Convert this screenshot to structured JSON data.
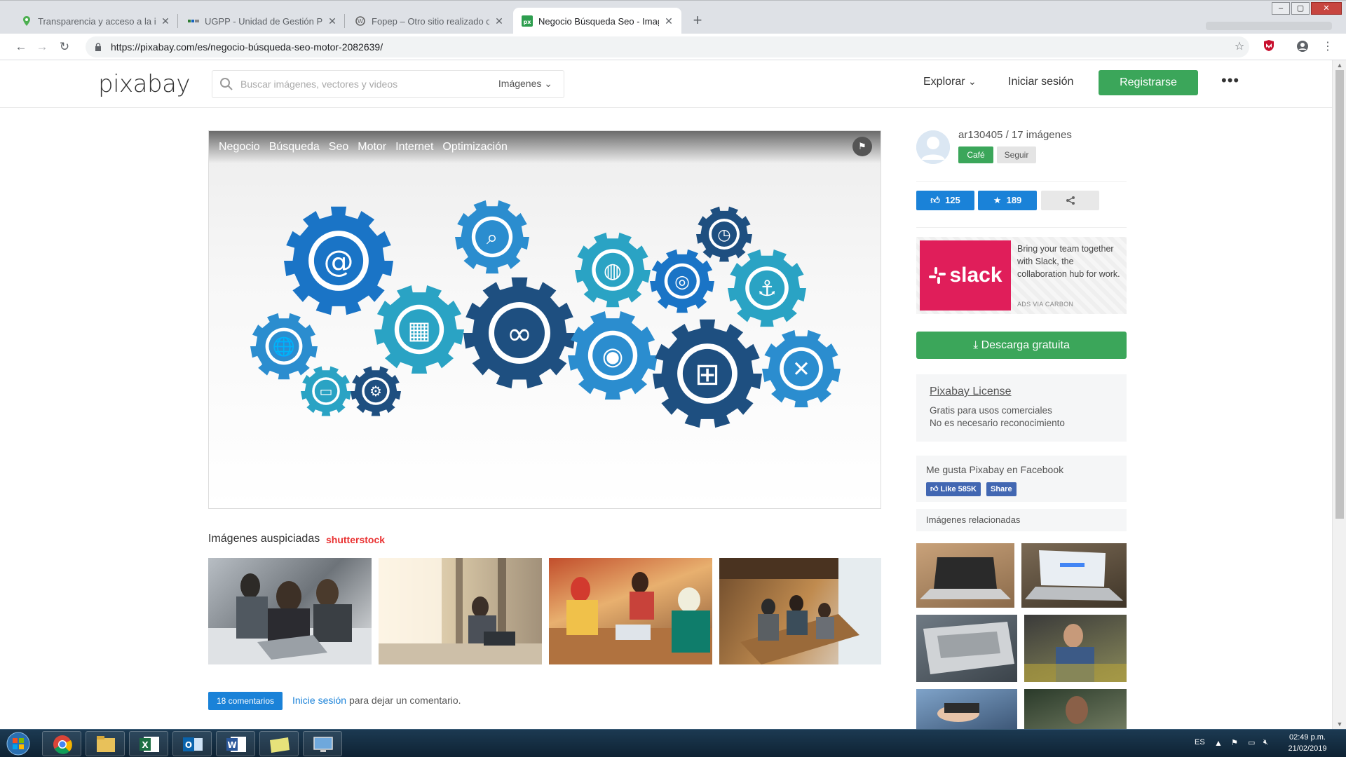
{
  "browser": {
    "tabs": [
      {
        "title": "Transparencia y acceso a la inform",
        "favicon": "location-pin-icon",
        "active": false
      },
      {
        "title": "UGPP - Unidad de Gestión Pensio",
        "favicon": "ugpp-icon",
        "active": false
      },
      {
        "title": "Fopep – Otro sitio realizado con",
        "favicon": "wordpress-icon",
        "active": false
      },
      {
        "title": "Negocio Búsqueda Seo - Imagen",
        "favicon": "pixabay-icon",
        "active": true
      }
    ],
    "url": "https://pixabay.com/es/negocio-búsqueda-seo-motor-2082639/"
  },
  "header": {
    "logo": "pixabay",
    "search_placeholder": "Buscar imágenes, vectores y videos",
    "search_type": "Imágenes",
    "explore": "Explorar",
    "login": "Iniciar sesión",
    "register": "Registrarse"
  },
  "image": {
    "tags": [
      "Negocio",
      "Búsqueda",
      "Seo",
      "Motor",
      "Internet",
      "Optimización"
    ]
  },
  "sponsored": {
    "title": "Imágenes auspiciadas",
    "provider": "shutterstock"
  },
  "comments": {
    "count_label": "18 comentarios",
    "login_link": "Inicie sesión",
    "rest": "para dejar un comentario."
  },
  "sidebar": {
    "user": "ar130405",
    "images_count": "17 imágenes",
    "badge": "Café",
    "follow": "Seguir",
    "likes": "125",
    "favorites": "189",
    "ad_text": "Bring your team together with Slack, the collaboration hub for work.",
    "ad_brand": "slack",
    "ad_via": "ADS VIA CARBON",
    "download": "Descarga gratuita",
    "license_title": "Pixabay License",
    "license_line1": "Gratis para usos comerciales",
    "license_line2": "No es necesario reconocimiento",
    "facebook_title": "Me gusta Pixabay en Facebook",
    "fb_like": "Like 585K",
    "fb_share": "Share",
    "related_title": "Imágenes relacionadas"
  },
  "taskbar": {
    "lang": "ES",
    "time": "02:49 p.m.",
    "date": "21/02/2019"
  },
  "colors": {
    "green": "#3ba65a",
    "blue": "#1a82d8",
    "slack": "#e01e5a"
  }
}
